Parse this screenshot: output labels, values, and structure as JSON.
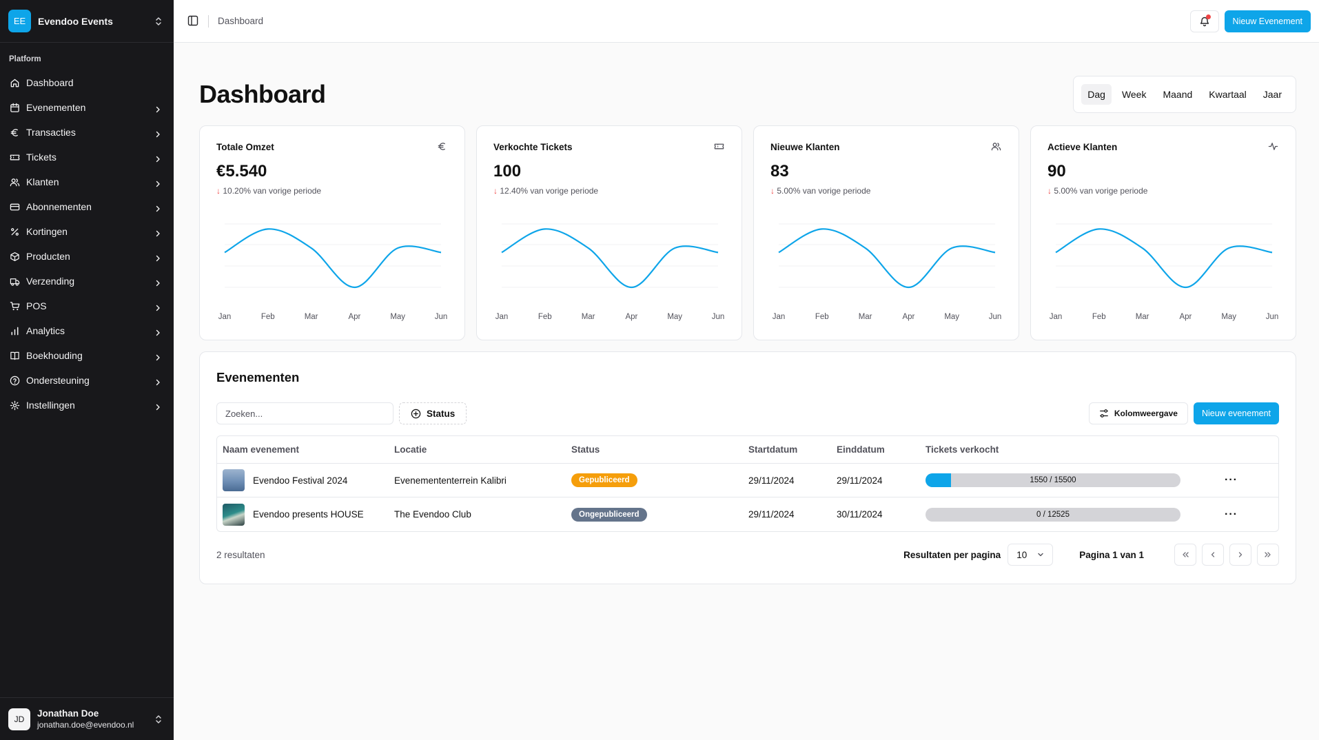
{
  "brand": {
    "initials": "EE",
    "name": "Evendoo Events"
  },
  "sidebar": {
    "group_label": "Platform",
    "items": [
      {
        "label": "Dashboard",
        "icon": "home-icon",
        "chevron": false
      },
      {
        "label": "Evenementen",
        "icon": "calendar-icon",
        "chevron": true
      },
      {
        "label": "Transacties",
        "icon": "euro-icon",
        "chevron": true
      },
      {
        "label": "Tickets",
        "icon": "ticket-icon",
        "chevron": true
      },
      {
        "label": "Klanten",
        "icon": "users-icon",
        "chevron": true
      },
      {
        "label": "Abonnementen",
        "icon": "credit-card-icon",
        "chevron": true
      },
      {
        "label": "Kortingen",
        "icon": "percent-icon",
        "chevron": true
      },
      {
        "label": "Producten",
        "icon": "package-icon",
        "chevron": true
      },
      {
        "label": "Verzending",
        "icon": "truck-icon",
        "chevron": true
      },
      {
        "label": "POS",
        "icon": "cart-icon",
        "chevron": true
      },
      {
        "label": "Analytics",
        "icon": "bar-chart-icon",
        "chevron": true
      },
      {
        "label": "Boekhouding",
        "icon": "book-icon",
        "chevron": true
      },
      {
        "label": "Ondersteuning",
        "icon": "help-circle-icon",
        "chevron": true
      },
      {
        "label": "Instellingen",
        "icon": "gear-icon",
        "chevron": true
      }
    ]
  },
  "user": {
    "initials": "JD",
    "name": "Jonathan Doe",
    "email": "jonathan.doe@evendoo.nl"
  },
  "topbar": {
    "breadcrumb": "Dashboard",
    "new_event_label": "Nieuw Evenement",
    "accent": "#0ea5e9"
  },
  "page": {
    "title": "Dashboard",
    "periods": [
      "Dag",
      "Week",
      "Maand",
      "Kwartaal",
      "Jaar"
    ],
    "active_period": "Dag"
  },
  "cards": [
    {
      "title": "Totale Omzet",
      "icon": "euro-icon",
      "value": "€5.540",
      "delta_arrow": "↓",
      "delta": "10.20% van vorige periode"
    },
    {
      "title": "Verkochte Tickets",
      "icon": "ticket-icon",
      "value": "100",
      "delta_arrow": "↓",
      "delta": "12.40% van vorige periode"
    },
    {
      "title": "Nieuwe Klanten",
      "icon": "users-icon",
      "value": "83",
      "delta_arrow": "↓",
      "delta": "5.00% van vorige periode"
    },
    {
      "title": "Actieve Klanten",
      "icon": "activity-icon",
      "value": "90",
      "delta_arrow": "↓",
      "delta": "5.00% van vorige periode"
    }
  ],
  "chart_data": [
    {
      "type": "line",
      "categories": [
        "Jan",
        "Feb",
        "Mar",
        "Apr",
        "May",
        "Jun"
      ],
      "values": [
        0.55,
        0.92,
        0.62,
        0.0,
        0.62,
        0.55
      ],
      "grid": true,
      "color": "#0ea5e9"
    },
    {
      "type": "line",
      "categories": [
        "Jan",
        "Feb",
        "Mar",
        "Apr",
        "May",
        "Jun"
      ],
      "values": [
        0.55,
        0.92,
        0.62,
        0.0,
        0.62,
        0.55
      ],
      "grid": true,
      "color": "#0ea5e9"
    },
    {
      "type": "line",
      "categories": [
        "Jan",
        "Feb",
        "Mar",
        "Apr",
        "May",
        "Jun"
      ],
      "values": [
        0.55,
        0.92,
        0.62,
        0.0,
        0.62,
        0.55
      ],
      "grid": true,
      "color": "#0ea5e9"
    },
    {
      "type": "line",
      "categories": [
        "Jan",
        "Feb",
        "Mar",
        "Apr",
        "May",
        "Jun"
      ],
      "values": [
        0.55,
        0.92,
        0.62,
        0.0,
        0.62,
        0.55
      ],
      "grid": true,
      "color": "#0ea5e9"
    }
  ],
  "events": {
    "title": "Evenementen",
    "search_placeholder": "Zoeken...",
    "status_filter": "Status",
    "columns_button": "Kolomweergave",
    "new_button": "Nieuw evenement",
    "headers": [
      "Naam evenement",
      "Locatie",
      "Status",
      "Startdatum",
      "Einddatum",
      "Tickets verkocht"
    ],
    "rows": [
      {
        "name": "Evendoo Festival 2024",
        "location": "Evenemententerrein Kalibri",
        "status": "Gepubliceerd",
        "status_color": "#f59e0b",
        "start": "29/11/2024",
        "end": "29/11/2024",
        "sold": 1550,
        "capacity": 15500,
        "tickets": "1550 / 15500"
      },
      {
        "name": "Evendoo presents HOUSE",
        "location": "The Evendoo Club",
        "status": "Ongepubliceerd",
        "status_color": "#64748b",
        "start": "29/11/2024",
        "end": "30/11/2024",
        "sold": 0,
        "capacity": 12525,
        "tickets": "0 / 12525"
      }
    ],
    "results": "2 resultaten",
    "per_page_label": "Resultaten per pagina",
    "per_page": "10",
    "page_info": "Pagina 1 van 1"
  }
}
